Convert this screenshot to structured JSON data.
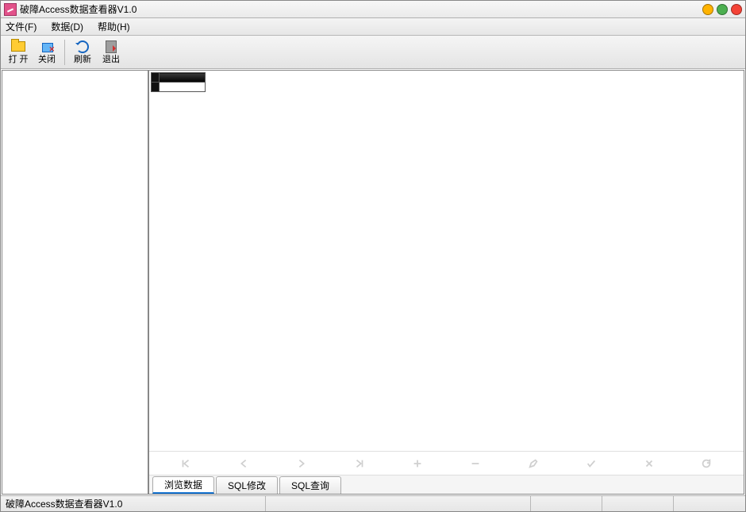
{
  "title": "破障Access数据查看器V1.0",
  "menus": {
    "file": "文件(F)",
    "data": "数据(D)",
    "help": "帮助(H)"
  },
  "toolbar": {
    "open": "打 开",
    "close": "关闭",
    "refresh": "刷新",
    "exit": "退出"
  },
  "tabs": {
    "browse": "浏览数据",
    "sqlmod": "SQL修改",
    "sqlquery": "SQL查询"
  },
  "status": {
    "text": "破障Access数据查看器V1.0"
  }
}
